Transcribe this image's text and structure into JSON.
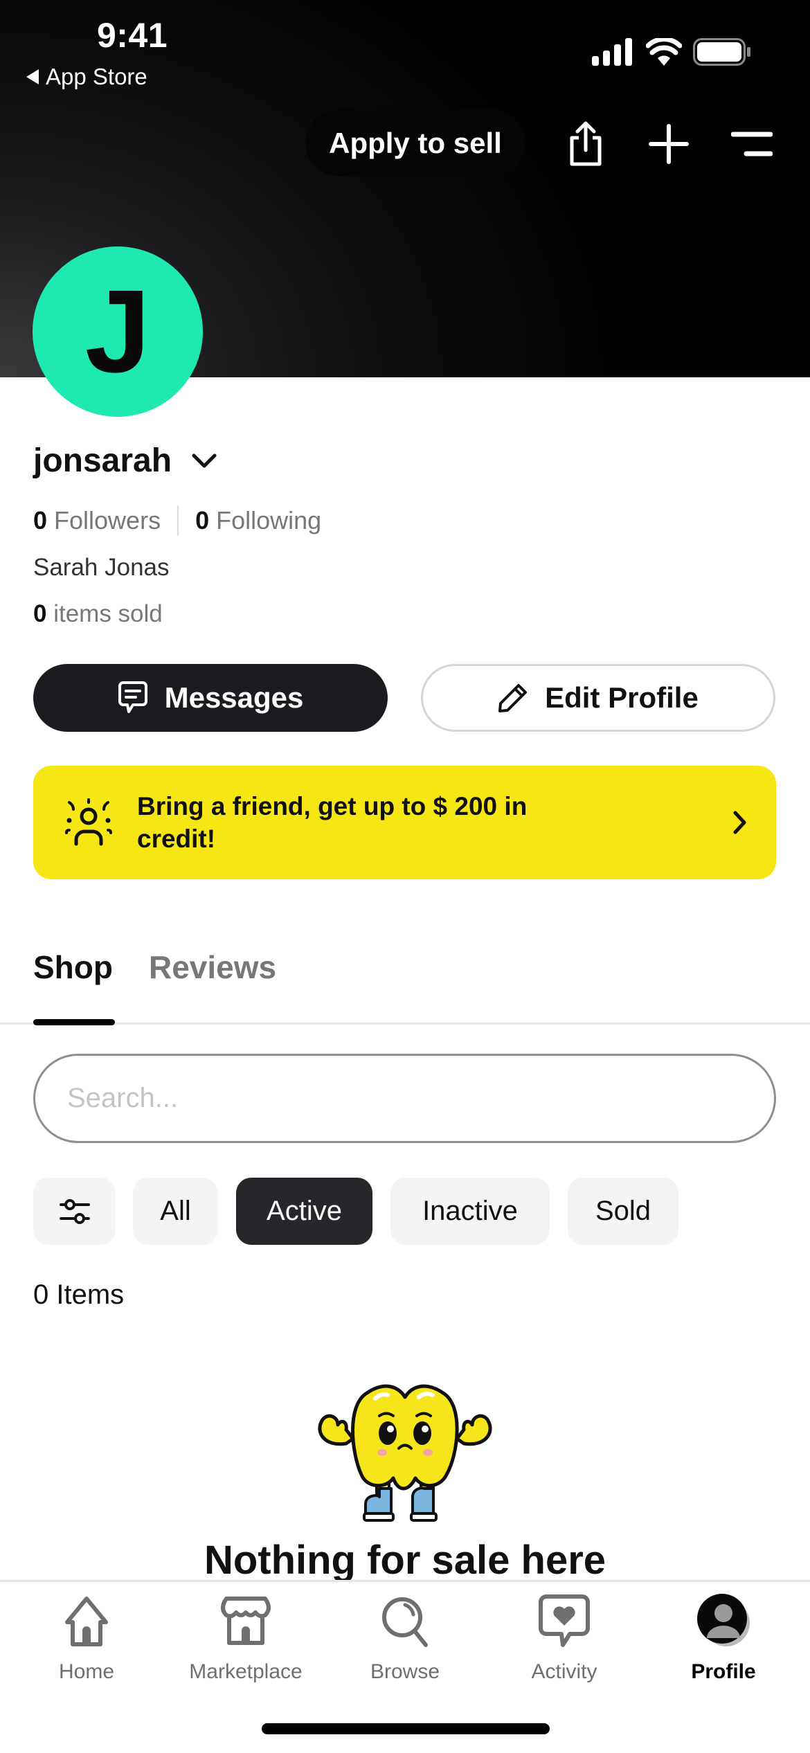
{
  "status_bar": {
    "time": "9:41",
    "back_app": "App Store",
    "icons": [
      "cellular-signal-icon",
      "wifi-icon",
      "battery-icon"
    ]
  },
  "header": {
    "apply_label": "Apply to sell",
    "icons": [
      "share-icon",
      "plus-icon",
      "menu-icon"
    ]
  },
  "profile": {
    "avatar_initial": "J",
    "avatar_color": "#1de9b0",
    "username": "jonsarah",
    "followers_count": "0",
    "followers_label": "Followers",
    "following_count": "0",
    "following_label": "Following",
    "full_name": "Sarah Jonas",
    "items_sold_count": "0",
    "items_sold_label": "items sold"
  },
  "actions": {
    "messages_label": "Messages",
    "edit_profile_label": "Edit Profile"
  },
  "referral_banner": {
    "text": "Bring a friend, get up to $ 200 in credit!",
    "color": "#f5e614"
  },
  "tabs": [
    {
      "label": "Shop",
      "active": true
    },
    {
      "label": "Reviews",
      "active": false
    }
  ],
  "search": {
    "placeholder": "Search...",
    "value": ""
  },
  "filters": {
    "chips": [
      {
        "label": "All",
        "active": false
      },
      {
        "label": "Active",
        "active": true
      },
      {
        "label": "Inactive",
        "active": false
      },
      {
        "label": "Sold",
        "active": false
      }
    ]
  },
  "items": {
    "count_label": "0 Items",
    "empty_title": "Nothing for sale here"
  },
  "bottom_nav": [
    {
      "label": "Home",
      "icon": "home-icon",
      "active": false
    },
    {
      "label": "Marketplace",
      "icon": "storefront-icon",
      "active": false
    },
    {
      "label": "Browse",
      "icon": "search-icon",
      "active": false
    },
    {
      "label": "Activity",
      "icon": "activity-heart-icon",
      "active": false
    },
    {
      "label": "Profile",
      "icon": "profile-avatar-icon",
      "active": true
    }
  ]
}
